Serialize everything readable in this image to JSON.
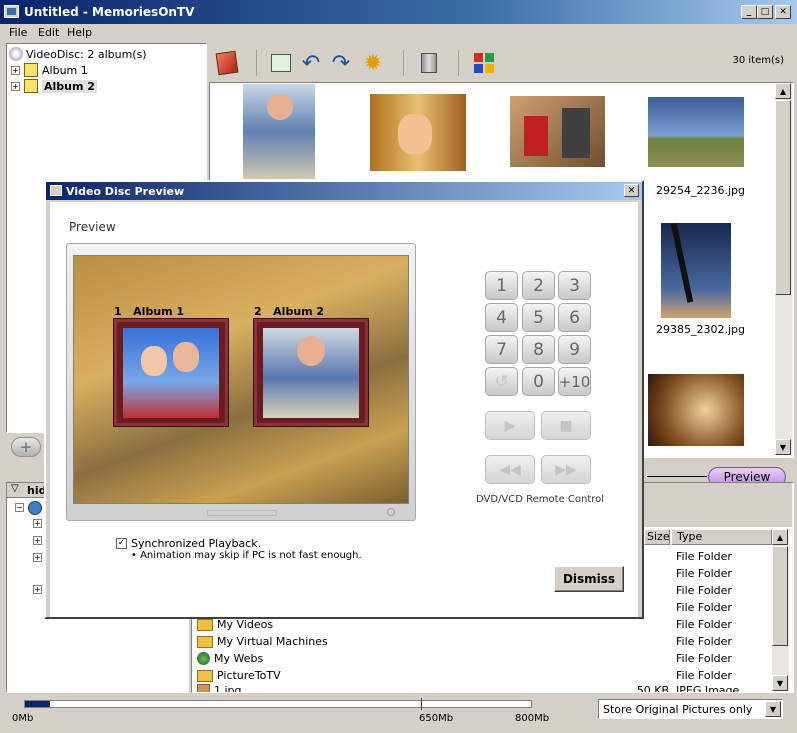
{
  "window": {
    "title": "Untitled - MemoriesOnTV",
    "min": "_",
    "max": "□",
    "close": "✕"
  },
  "menu": [
    "File",
    "Edit",
    "Help"
  ],
  "tree": {
    "root": "VideoDisc: 2 album(s)",
    "albums": [
      "Album 1",
      "Album 2"
    ],
    "expander": "+"
  },
  "toolbar": {
    "count": "30 item(s)",
    "icons": [
      "add-photo-icon",
      "image-edit-icon",
      "rotate-left-icon",
      "rotate-right-icon",
      "settings-gear-icon",
      "trash-icon",
      "grid-view-icon"
    ]
  },
  "thumbnails": [
    {
      "caption": "29254_2236.jpg",
      "color": "#3d5f9a"
    },
    {
      "caption": "29385_2302.jpg",
      "color": "#16284e"
    }
  ],
  "preview_button": "Preview",
  "folder_pane_header": "hid",
  "file_table": {
    "headers": {
      "size": "Size",
      "type": "Type"
    },
    "rows": [
      {
        "name": "",
        "type": "File Folder",
        "size": ""
      },
      {
        "name": "",
        "type": "File Folder",
        "size": ""
      },
      {
        "name": "",
        "type": "File Folder",
        "size": ""
      },
      {
        "name": "",
        "type": "File Folder",
        "size": ""
      },
      {
        "name": "My Videos",
        "type": "File Folder",
        "size": ""
      },
      {
        "name": "My Virtual Machines",
        "type": "File Folder",
        "size": ""
      },
      {
        "name": "My Webs",
        "type": "File Folder",
        "size": ""
      },
      {
        "name": "PictureToTV",
        "type": "File Folder",
        "size": ""
      },
      {
        "name": "1.jpg",
        "type": "JPEG Image",
        "size": "50 KB"
      }
    ]
  },
  "status": {
    "capacity_labels": [
      "0Mb",
      "650Mb",
      "800Mb"
    ],
    "capacity_used_fraction": 0.05,
    "store_option": "Store Original Pictures only"
  },
  "dialog": {
    "title": "Video Disc Preview",
    "close": "✕",
    "section_label": "Preview",
    "menu_albums": [
      {
        "number": "1",
        "name": "Album 1"
      },
      {
        "number": "2",
        "name": "Album 2"
      }
    ],
    "keypad": [
      "1",
      "2",
      "3",
      "4",
      "5",
      "6",
      "7",
      "8",
      "9",
      "↺",
      "0",
      "+10"
    ],
    "controls": [
      "▶",
      "■",
      "◀◀",
      "▶▶"
    ],
    "remote_label": "DVD/VCD Remote Control",
    "sync_checked": true,
    "sync_label": "Synchronized Playback.",
    "sync_note": "• Animation may skip if PC is not fast enough.",
    "dismiss": "Dismiss"
  }
}
